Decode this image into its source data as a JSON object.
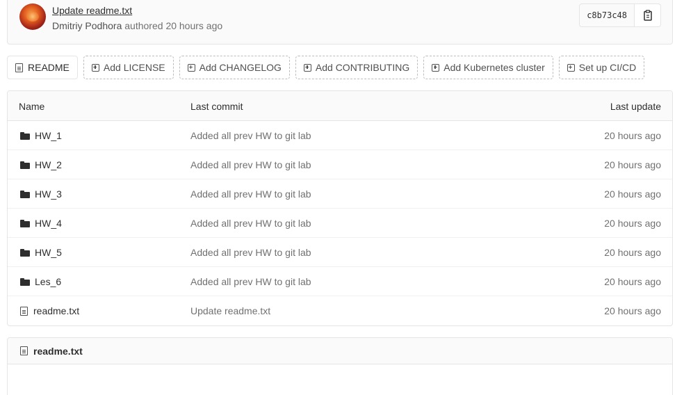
{
  "commit": {
    "title": "Update readme.txt",
    "author": "Dmitriy Podhora",
    "action": "authored",
    "time": "20 hours ago",
    "sha": "c8b73c48"
  },
  "actions": {
    "readme": "README",
    "license": "Add LICENSE",
    "changelog": "Add CHANGELOG",
    "contributing": "Add CONTRIBUTING",
    "kubernetes": "Add Kubernetes cluster",
    "cicd": "Set up CI/CD"
  },
  "table": {
    "headers": {
      "name": "Name",
      "last_commit": "Last commit",
      "last_update": "Last update"
    },
    "rows": [
      {
        "type": "folder",
        "name": "HW_1",
        "commit": "Added all prev HW to git lab",
        "updated": "20 hours ago"
      },
      {
        "type": "folder",
        "name": "HW_2",
        "commit": "Added all prev HW to git lab",
        "updated": "20 hours ago"
      },
      {
        "type": "folder",
        "name": "HW_3",
        "commit": "Added all prev HW to git lab",
        "updated": "20 hours ago"
      },
      {
        "type": "folder",
        "name": "HW_4",
        "commit": "Added all prev HW to git lab",
        "updated": "20 hours ago"
      },
      {
        "type": "folder",
        "name": "HW_5",
        "commit": "Added all prev HW to git lab",
        "updated": "20 hours ago"
      },
      {
        "type": "folder",
        "name": "Les_6",
        "commit": "Added all prev HW to git lab",
        "updated": "20 hours ago"
      },
      {
        "type": "file",
        "name": "readme.txt",
        "commit": "Update readme.txt",
        "updated": "20 hours ago"
      }
    ]
  },
  "readme_panel": {
    "title": "readme.txt"
  },
  "icons": {
    "folder": "folder-icon",
    "file": "file-icon",
    "copy": "clipboard-icon",
    "add": "plus-square-icon"
  }
}
